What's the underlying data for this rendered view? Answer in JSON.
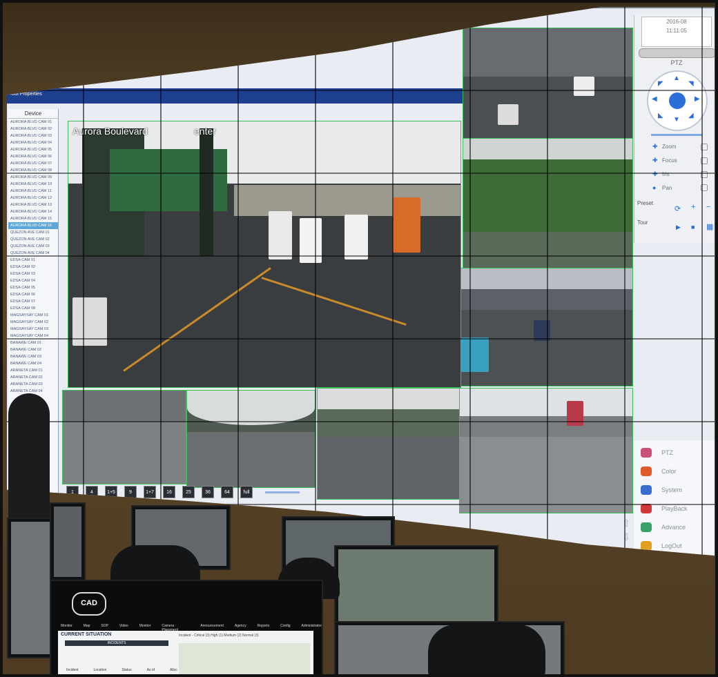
{
  "video_wall": {
    "tab_label": "Tool Properties",
    "device_panel": {
      "header": "Device",
      "items": [
        "AURORA BLVD CAM 01",
        "AURORA BLVD CAM 02",
        "AURORA BLVD CAM 03",
        "AURORA BLVD CAM 04",
        "AURORA BLVD CAM 05",
        "AURORA BLVD CAM 06",
        "AURORA BLVD CAM 07",
        "AURORA BLVD CAM 08",
        "AURORA BLVD CAM 09",
        "AURORA BLVD CAM 10",
        "AURORA BLVD CAM 11",
        "AURORA BLVD CAM 12",
        "AURORA BLVD CAM 13",
        "AURORA BLVD CAM 14",
        "AURORA BLVD CAM 15",
        "AURORA BLVD CAM 16",
        "QUEZON AVE CAM 01",
        "QUEZON AVE CAM 02",
        "QUEZON AVE CAM 03",
        "QUEZON AVE CAM 04",
        "EDSA CAM 01",
        "EDSA CAM 02",
        "EDSA CAM 03",
        "EDSA CAM 04",
        "EDSA CAM 05",
        "EDSA CAM 06",
        "EDSA CAM 07",
        "EDSA CAM 08",
        "MAGSAYSAY CAM 01",
        "MAGSAYSAY CAM 02",
        "MAGSAYSAY CAM 03",
        "MAGSAYSAY CAM 04",
        "BANAWE CAM 01",
        "BANAWE CAM 02",
        "BANAWE CAM 03",
        "BANAWE CAM 04",
        "ARANETA CAM 01",
        "ARANETA CAM 02",
        "ARANETA CAM 03",
        "ARANETA CAM 04"
      ],
      "selected_index": 15
    },
    "main_feed_title": "Aurora Boulevard",
    "main_feed_title_right": "enter",
    "bottom_feed_titles": [
      "",
      "",
      ""
    ],
    "layout_buttons": [
      "1",
      "4",
      "1+5",
      "9",
      "1+7",
      "16",
      "25",
      "36",
      "64",
      "full"
    ],
    "ptz": {
      "date_line1": "2016-08",
      "date_line2": "11:11:05",
      "title": "PTZ",
      "rows": [
        {
          "icon": "plus-icon",
          "label": "Zoom"
        },
        {
          "icon": "plus-icon",
          "label": "Focus"
        },
        {
          "icon": "plus-icon",
          "label": "Iris"
        },
        {
          "icon": "dot-icon",
          "label": "Pan"
        }
      ],
      "preset_label": "Preset",
      "tour_label": "Tour"
    },
    "menu": [
      {
        "label": "PTZ",
        "icon": "ptz-icon",
        "color": "#c9507a"
      },
      {
        "label": "Color",
        "icon": "color-icon",
        "color": "#e05a2a"
      },
      {
        "label": "System",
        "icon": "system-icon",
        "color": "#3a6fd0"
      },
      {
        "label": "PlayBack",
        "icon": "playback-icon",
        "color": "#d23a3a"
      },
      {
        "label": "Advance",
        "icon": "advance-icon",
        "color": "#3aa06a"
      },
      {
        "label": "LogOut",
        "icon": "logout-icon",
        "color": "#e0a020"
      }
    ]
  },
  "cad_monitor": {
    "logo": "CAD",
    "nav": [
      "Monitor",
      "Map",
      "SOP",
      "Video",
      "Monitor",
      "Camera Placement",
      "Announcement",
      "Agency",
      "Reports",
      "Config",
      "Administrator"
    ],
    "heading": "CURRENT SITUATION",
    "subbar": "INCIDENTS",
    "status": "Incident - Critical (3)   High (1)   Medium (2)   Normal (3)",
    "columns": [
      "Incident",
      "Location",
      "Status",
      "As of",
      "Alloc"
    ]
  },
  "colors": {
    "wall_bg": "#e9ecf2",
    "wall_topbar": "#1f3f8f",
    "feed_border": "#3bbf5a",
    "ptz_accent": "#2a6fd8"
  }
}
